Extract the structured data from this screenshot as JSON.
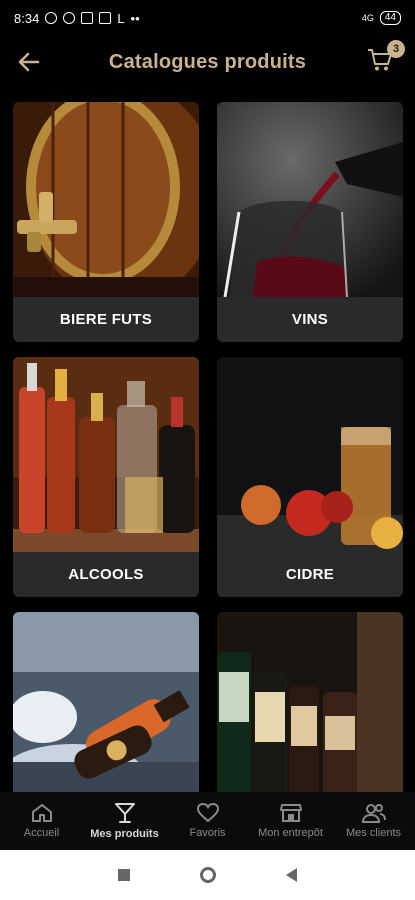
{
  "status": {
    "time": "8:34",
    "letter": "L",
    "dots": "••",
    "signal": "4G",
    "battery": "44"
  },
  "header": {
    "title": "Catalogues produits",
    "cart_count": "3"
  },
  "catalog": [
    {
      "label": "BIERE FUTS",
      "image": "wooden-barrel-tap"
    },
    {
      "label": "VINS",
      "image": "wine-pour-glass"
    },
    {
      "label": "ALCOOLS",
      "image": "liquor-bottles"
    },
    {
      "label": "CIDRE",
      "image": "cider-apples"
    },
    {
      "label": "",
      "image": "bottles-on-ice"
    },
    {
      "label": "",
      "image": "beer-bottles"
    }
  ],
  "bottom_nav": [
    {
      "label": "Accueil",
      "icon": "home-icon",
      "active": false
    },
    {
      "label": "Mes produits",
      "icon": "cocktail-icon",
      "active": true
    },
    {
      "label": "Favoris",
      "icon": "heart-icon",
      "active": false
    },
    {
      "label": "Mon entrepôt",
      "icon": "store-icon",
      "active": false
    },
    {
      "label": "Mes clients",
      "icon": "users-icon",
      "active": false
    }
  ],
  "colors": {
    "accent": "#c9b28c",
    "background": "#000000",
    "card_label_bg": "#2a2a2a"
  }
}
